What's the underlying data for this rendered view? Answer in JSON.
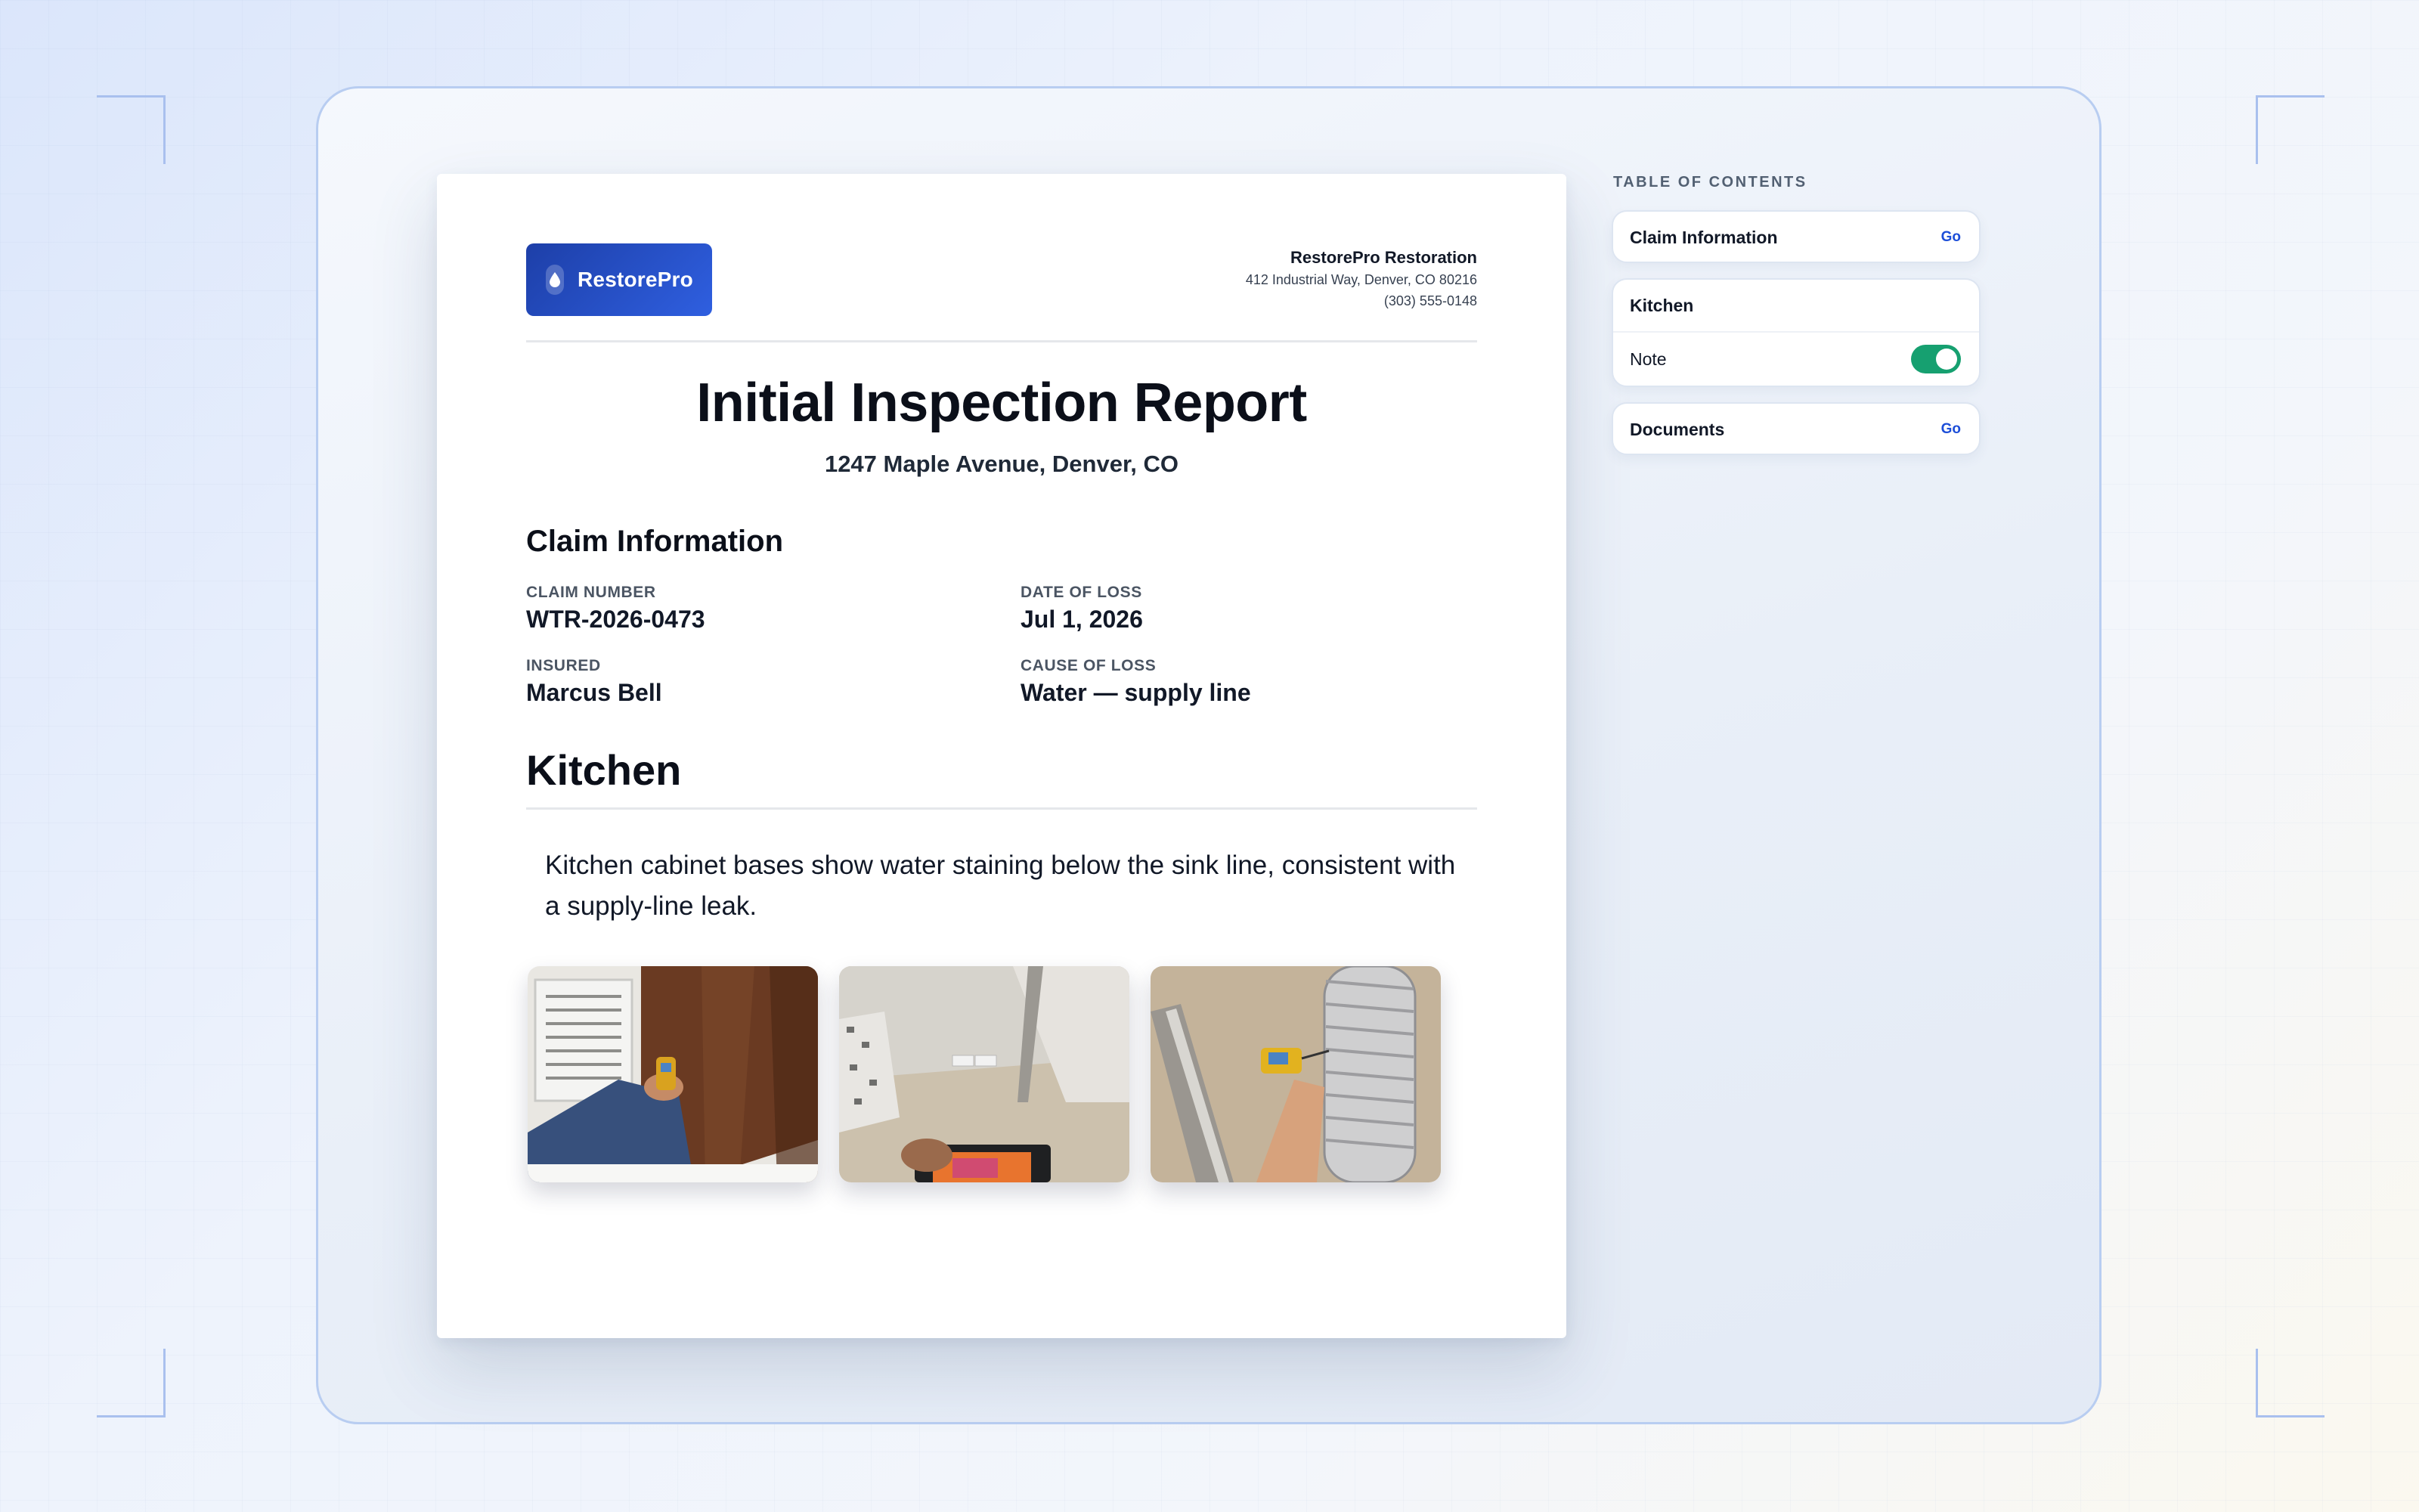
{
  "company": {
    "logo_text": "RestorePro",
    "name": "RestorePro Restoration",
    "address": "412 Industrial Way, Denver, CO 80216",
    "phone": "(303) 555-0148"
  },
  "report": {
    "title": "Initial Inspection Report",
    "address": "1247 Maple Avenue, Denver, CO"
  },
  "claim": {
    "heading": "Claim Information",
    "fields": [
      {
        "label": "Claim Number",
        "value": "WTR-2026-0473"
      },
      {
        "label": "Date of Loss",
        "value": "Jul 1, 2026"
      },
      {
        "label": "Insured",
        "value": "Marcus Bell"
      },
      {
        "label": "Cause of Loss",
        "value": "Water — supply line"
      }
    ]
  },
  "kitchen": {
    "heading": "Kitchen",
    "note": "Kitchen cabinet bases show water staining below the sink line, consistent with a supply-line leak."
  },
  "toc": {
    "label": "TABLE OF CONTENTS",
    "items": [
      {
        "title": "Claim Information",
        "action": "Go"
      },
      {
        "title": "Kitchen",
        "sub_label": "Note",
        "note_enabled": true
      },
      {
        "title": "Documents",
        "action": "Go"
      }
    ]
  },
  "colors": {
    "accent": "#1d4ed8",
    "toggle_on": "#16a070",
    "logo_gradient_start": "#1d3fa8",
    "logo_gradient_end": "#2f5fe0"
  },
  "icons": {
    "logo": "water-drop-icon"
  }
}
